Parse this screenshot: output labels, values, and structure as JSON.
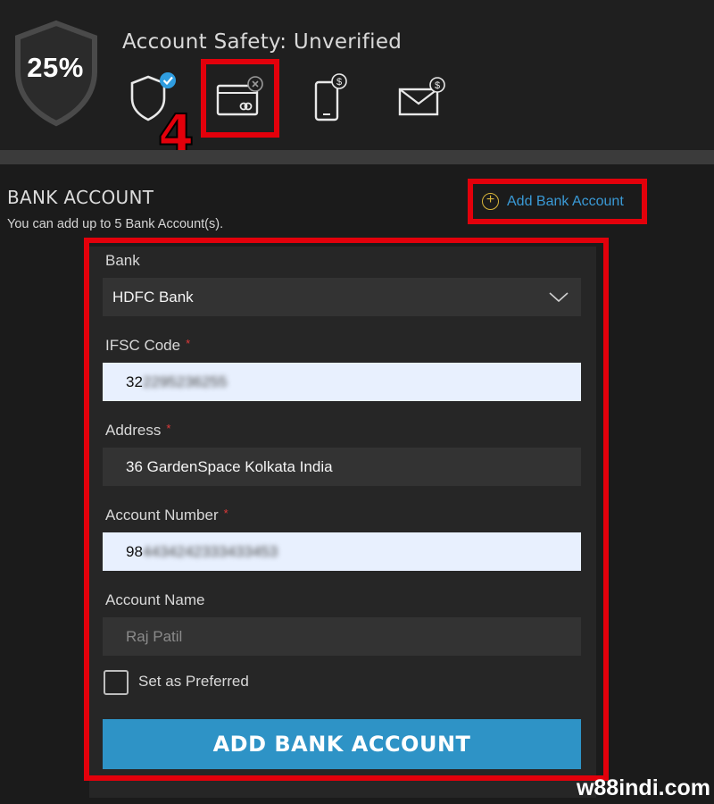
{
  "safety": {
    "percent": "25%",
    "title": "Account Safety: Unverified",
    "icons": [
      {
        "name": "shield-verified-icon",
        "status": "verified"
      },
      {
        "name": "bank-card-icon",
        "status": "unverified"
      },
      {
        "name": "phone-dollar-icon",
        "status": "pending"
      },
      {
        "name": "email-dollar-icon",
        "status": "pending"
      }
    ],
    "step_marker": "4"
  },
  "bank_section": {
    "title": "BANK ACCOUNT",
    "subtitle": "You can add up to 5 Bank Account(s).",
    "add_link": "Add Bank Account"
  },
  "form": {
    "bank_label": "Bank",
    "bank_value": "HDFC Bank",
    "ifsc_label": "IFSC Code",
    "ifsc_value": "32",
    "ifsc_masked": "2295236255",
    "address_label": "Address",
    "address_value": "36 GardenSpace Kolkata India",
    "account_number_label": "Account Number",
    "account_number_value": "98",
    "account_number_masked": "4434242333433453",
    "account_name_label": "Account Name",
    "account_name_value": "Raj Patil",
    "preferred_label": "Set as Preferred",
    "preferred_checked": false,
    "submit_label": "ADD BANK ACCOUNT",
    "required_mark": "*"
  },
  "watermark": "w88indi.com",
  "colors": {
    "accent_red": "#e3000b",
    "button_blue": "#2e93c6",
    "link_blue": "#3a9ad6",
    "verified_badge": "#2f9de0",
    "required_red": "#e03a3a"
  }
}
